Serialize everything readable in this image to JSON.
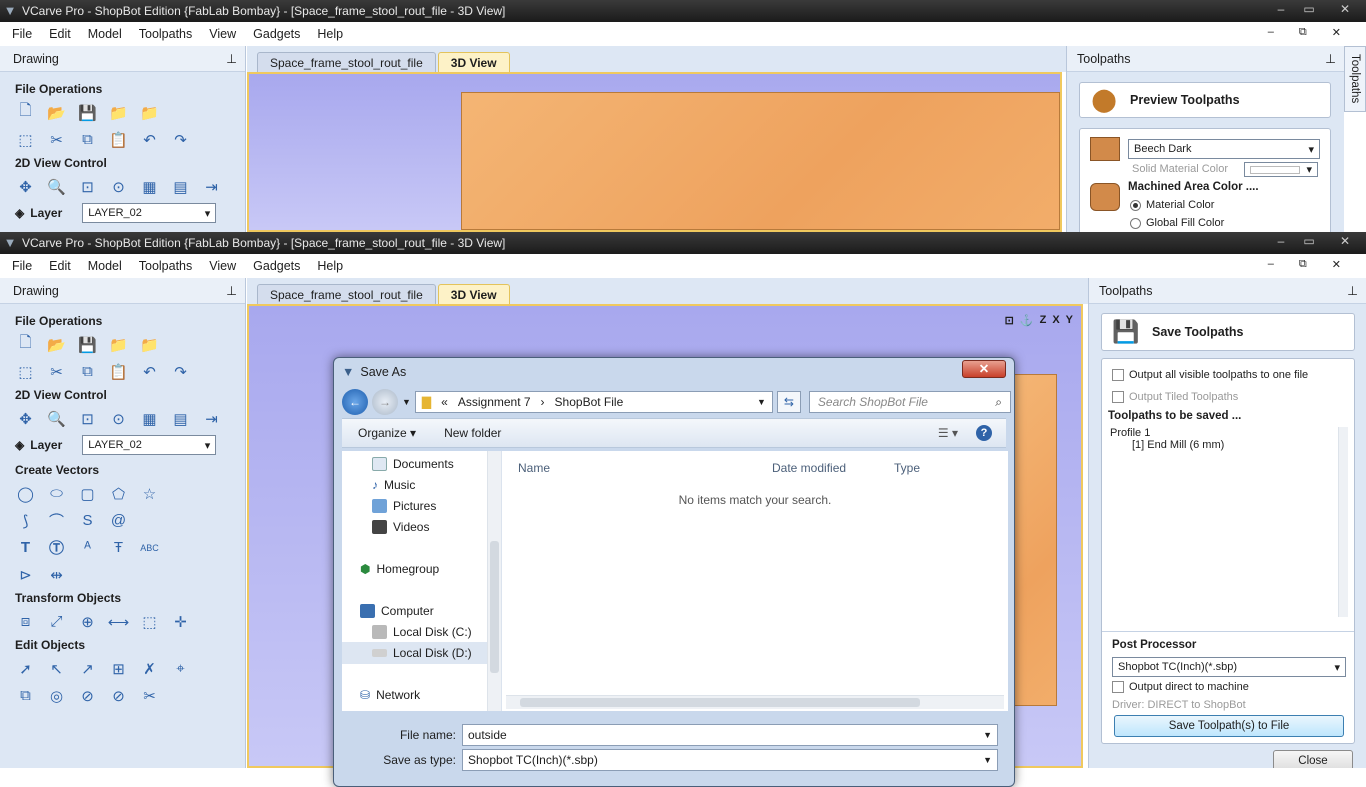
{
  "window": {
    "title": "VCarve Pro - ShopBot Edition {FabLab Bombay} - [Space_frame_stool_rout_file - 3D View]",
    "controls": {
      "minimize": "–",
      "maximize": "▭",
      "close": "✕"
    }
  },
  "menu": [
    "File",
    "Edit",
    "Model",
    "Toolpaths",
    "View",
    "Gadgets",
    "Help"
  ],
  "mdi_controls": {
    "minimize": "–",
    "restore": "⧉",
    "close": "✕"
  },
  "left_panel": {
    "title": "Drawing",
    "pin": "📌",
    "sections": {
      "file_ops": "File Operations",
      "view_control": "2D View Control",
      "create_vectors": "Create Vectors",
      "transform": "Transform Objects",
      "edit": "Edit Objects"
    },
    "layer_label": "Layer",
    "layer_value": "LAYER_02",
    "layer_value_top": "LAYER_02"
  },
  "tabs": [
    "Space_frame_stool_rout_file",
    "3D View"
  ],
  "view_axis_labels": [
    "Z",
    "X",
    "Y"
  ],
  "top_right_panel": {
    "title": "Toolpaths",
    "preview_button": "Preview Toolpaths",
    "material": "Beech Dark",
    "solid_material_color": "Solid Material Color",
    "machined_area_color": "Machined Area Color ....",
    "material_color": "Material Color",
    "global_fill_color": "Global Fill Color",
    "side_tab": "Toolpaths"
  },
  "right_panel": {
    "title": "Toolpaths",
    "save_button": "Save Toolpaths",
    "output_all": "Output all visible toolpaths to one file",
    "output_tiled": "Output Tiled Toolpaths",
    "to_be_saved_header": "Toolpaths to be saved ...",
    "profile": "Profile 1",
    "profile_tool": "[1] End Mill (6 mm)",
    "post_processor_label": "Post Processor",
    "post_processor_value": "Shopbot TC(Inch)(*.sbp)",
    "output_direct": "Output direct to machine",
    "driver_text": "Driver: DIRECT to ShopBot",
    "save_to_file_button": "Save Toolpath(s) to File",
    "close_button": "Close"
  },
  "dialog": {
    "title": "Save As",
    "close_label": "✕",
    "breadcrumb": [
      "«",
      "Assignment 7",
      "›",
      "ShopBot File"
    ],
    "search_placeholder": "Search ShopBot File",
    "organize": "Organize ▾",
    "new_folder": "New folder",
    "nav_items": [
      "Documents",
      "Music",
      "Pictures",
      "Videos",
      "Homegroup",
      "Computer",
      "Local Disk (C:)",
      "Local Disk (D:)",
      "Network"
    ],
    "columns": [
      "Name",
      "Date modified",
      "Type"
    ],
    "empty_message": "No items match your search.",
    "file_name_label": "File name:",
    "file_name_value": "outside",
    "save_type_label": "Save as type:",
    "save_type_value": "Shopbot TC(Inch)(*.sbp)"
  },
  "colors": {
    "panel_bg": "#dde7f4",
    "view_bg": "#b4b4f0",
    "wood": "#f0a864",
    "active_tab": "#fdf2c7"
  }
}
